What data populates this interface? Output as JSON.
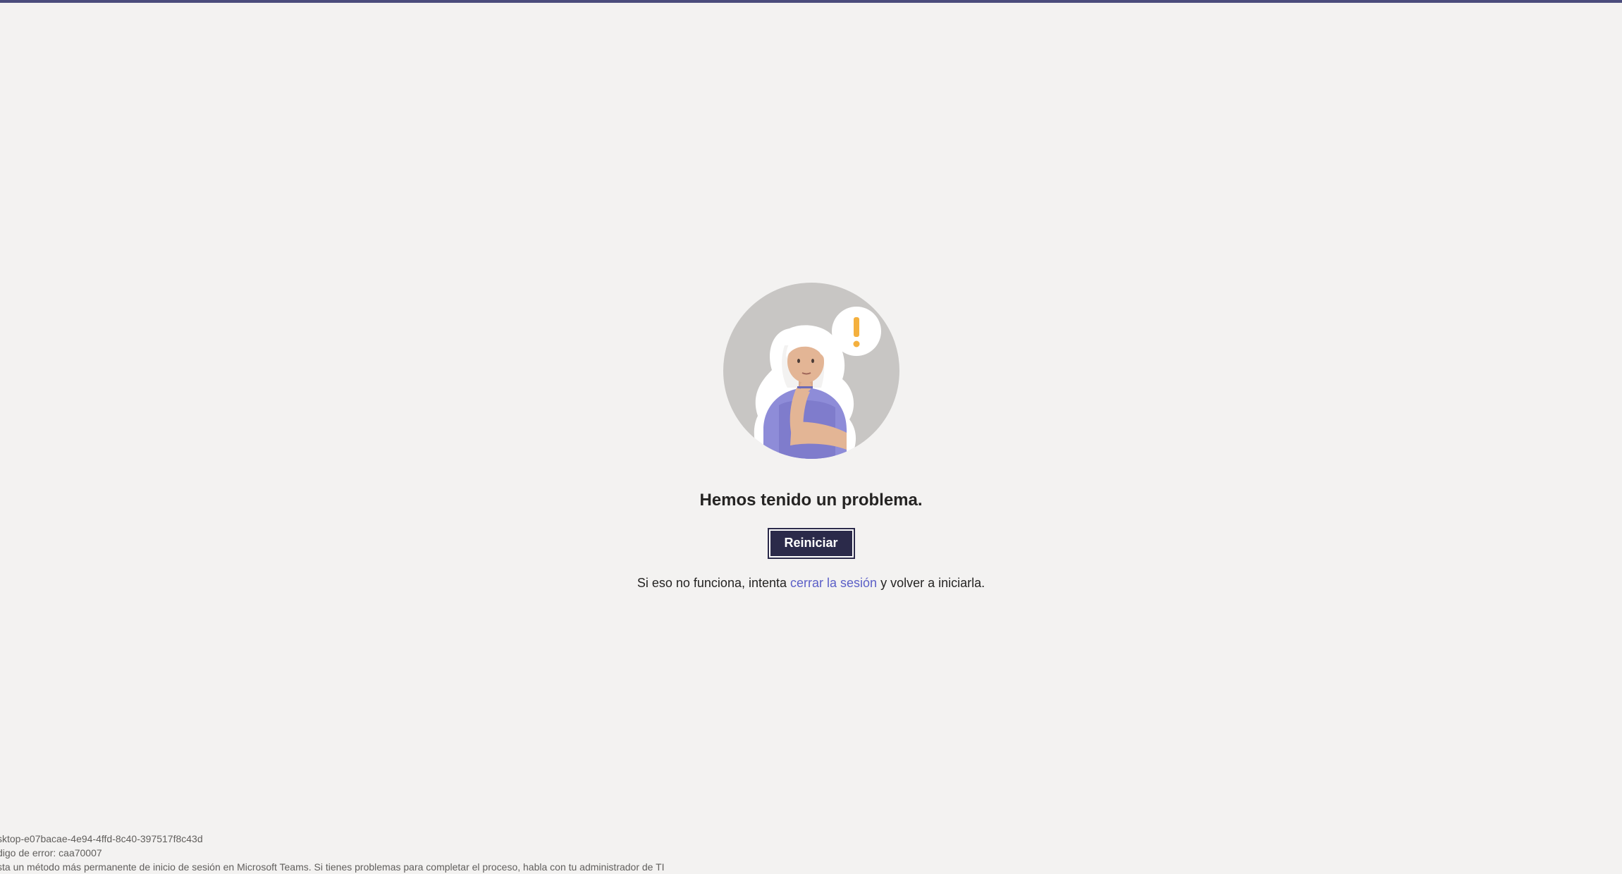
{
  "error_page": {
    "title": "Hemos tenido un problema.",
    "restart_label": "Reiniciar",
    "help_prefix": "Si eso no funciona, intenta ",
    "signout_link": "cerrar la sesión",
    "help_suffix": " y volver a iniciarla."
  },
  "footer": {
    "session_id": "sktop-e07bacae-4e94-4ffd-8c40-397517f8c43d",
    "error_code": "digo de error: caa70007",
    "note": "sta un método más permanente de inicio de sesión en Microsoft Teams. Si tienes problemas para completar el proceso, habla con tu administrador de TI"
  },
  "colors": {
    "background": "#f3f2f1",
    "accent": "#4b4c7c",
    "button": "#2b2a4a",
    "link": "#5b5fc7",
    "warning": "#f4b03e"
  },
  "icons": {
    "illustration": "thinking-woman-illustration",
    "thought": "exclamation-icon"
  }
}
